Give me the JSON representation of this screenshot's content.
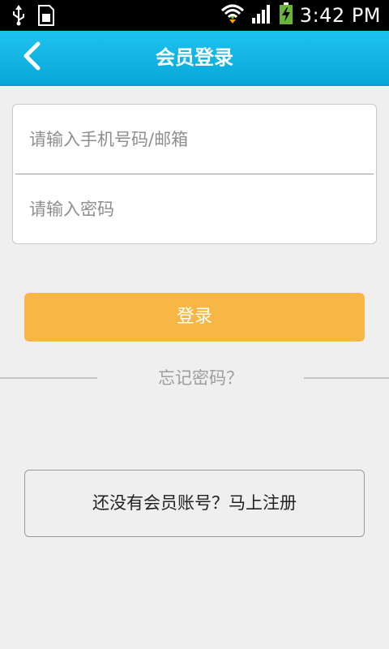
{
  "status_bar": {
    "time": "3:42 PM",
    "icons": [
      "usb-icon",
      "sim-icon",
      "wifi-icon",
      "signal-icon",
      "battery-charging-icon"
    ]
  },
  "header": {
    "title": "会员登录",
    "back_icon": "chevron-left-icon",
    "color": "#0fb4e4"
  },
  "form": {
    "account_placeholder": "请输入手机号码/邮箱",
    "account_value": "",
    "password_placeholder": "请输入密码",
    "password_value": ""
  },
  "actions": {
    "login_label": "登录",
    "login_color": "#f8b744",
    "forgot_label": "忘记密码？",
    "register_label": "还没有会员账号？马上注册"
  }
}
